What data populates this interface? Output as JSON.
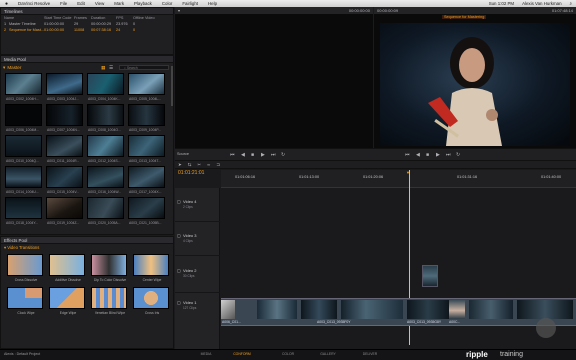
{
  "menubar": {
    "apple": "",
    "items": [
      "DaVinci Resolve",
      "File",
      "Edit",
      "View",
      "Mark",
      "Playback",
      "Color",
      "Fairlight",
      "Help"
    ],
    "clock": "Sun 1:02 PM",
    "user": "Alexis Van Hurkman"
  },
  "timelines": {
    "title": "Timelines",
    "columns": [
      "Name",
      "Start Time Code",
      "Frames",
      "Duration",
      "FPS",
      "Offline Video"
    ],
    "rows": [
      [
        "1",
        "Master Timeline",
        "01:00:00:00",
        "29",
        "00:00:00:29",
        "23.976",
        "0"
      ],
      [
        "2",
        "Sequence for Mast...",
        "01:00:00:00",
        "11008",
        "00:07:38:16",
        "24",
        "0"
      ]
    ]
  },
  "media_pool": {
    "title": "Media Pool",
    "bin": "Master",
    "search": "Search",
    "clips": [
      "A003_C002_1004H...",
      "A003_C003_1004J...",
      "A003_C004_1004K...",
      "A003_C005_1004L...",
      "A003_C006_1004M...",
      "A003_C007_1004N...",
      "A003_C008_1004O...",
      "A003_C009_1004P...",
      "A003_C010_1004Q...",
      "A003_C011_1004R...",
      "A003_C012_1004S...",
      "A003_C013_1004T...",
      "A003_C014_1004U...",
      "A003_C015_1004V...",
      "A003_C016_1004W...",
      "A003_C017_1004X...",
      "A003_C018_1004Y...",
      "A003_C019_1004Z...",
      "A003_C020_1005A...",
      "A003_C021_1005B..."
    ]
  },
  "effects": {
    "title": "Effects Pool",
    "category": "Video Transitions",
    "items": [
      "Cross Dissolve",
      "Additive Dissolve",
      "Dip To Color Dissolve",
      "Center Wipe",
      "Clock Wipe",
      "Edge Wipe",
      "Venetian Blind Wipe",
      "Cross Iris"
    ]
  },
  "source_viewer": {
    "timecode": "00:00:00:00"
  },
  "program_viewer": {
    "timecode": "00:00:00:09",
    "name": "Sequence for Mastering",
    "duration": "01:07:48:14"
  },
  "transport": {
    "source_label": "Source",
    "tc": "01:01:21:01"
  },
  "timeline": {
    "current_tc": "01:01:21:01",
    "ruler": [
      "01:01:06:16",
      "01:01:13:00",
      "01:01:20:06",
      "01:01:31:16",
      "01:01:40:00"
    ],
    "tracks": [
      {
        "name": "Video 4",
        "sub": "2 Clips"
      },
      {
        "name": "Video 3",
        "sub": "4 Clips"
      },
      {
        "name": "Video 2",
        "sub": "30 Clips"
      },
      {
        "name": "Video 1",
        "sub": "127 Clips"
      }
    ],
    "clip_labels": [
      "A006_C01...",
      "A003_C013_0935F0Y",
      "A003_C013_0935G8Y",
      "A00C..."
    ]
  },
  "bottombar": {
    "project": "Alexis : Default Project",
    "pages": [
      "MEDIA",
      "CONFORM",
      "COLOR",
      "GALLERY",
      "DELIVER"
    ],
    "active_page": "CONFORM",
    "watermark_a": "ripple",
    "watermark_b": "training"
  },
  "colors": {
    "accent": "#f0a020",
    "panel": "#1f1f22"
  }
}
